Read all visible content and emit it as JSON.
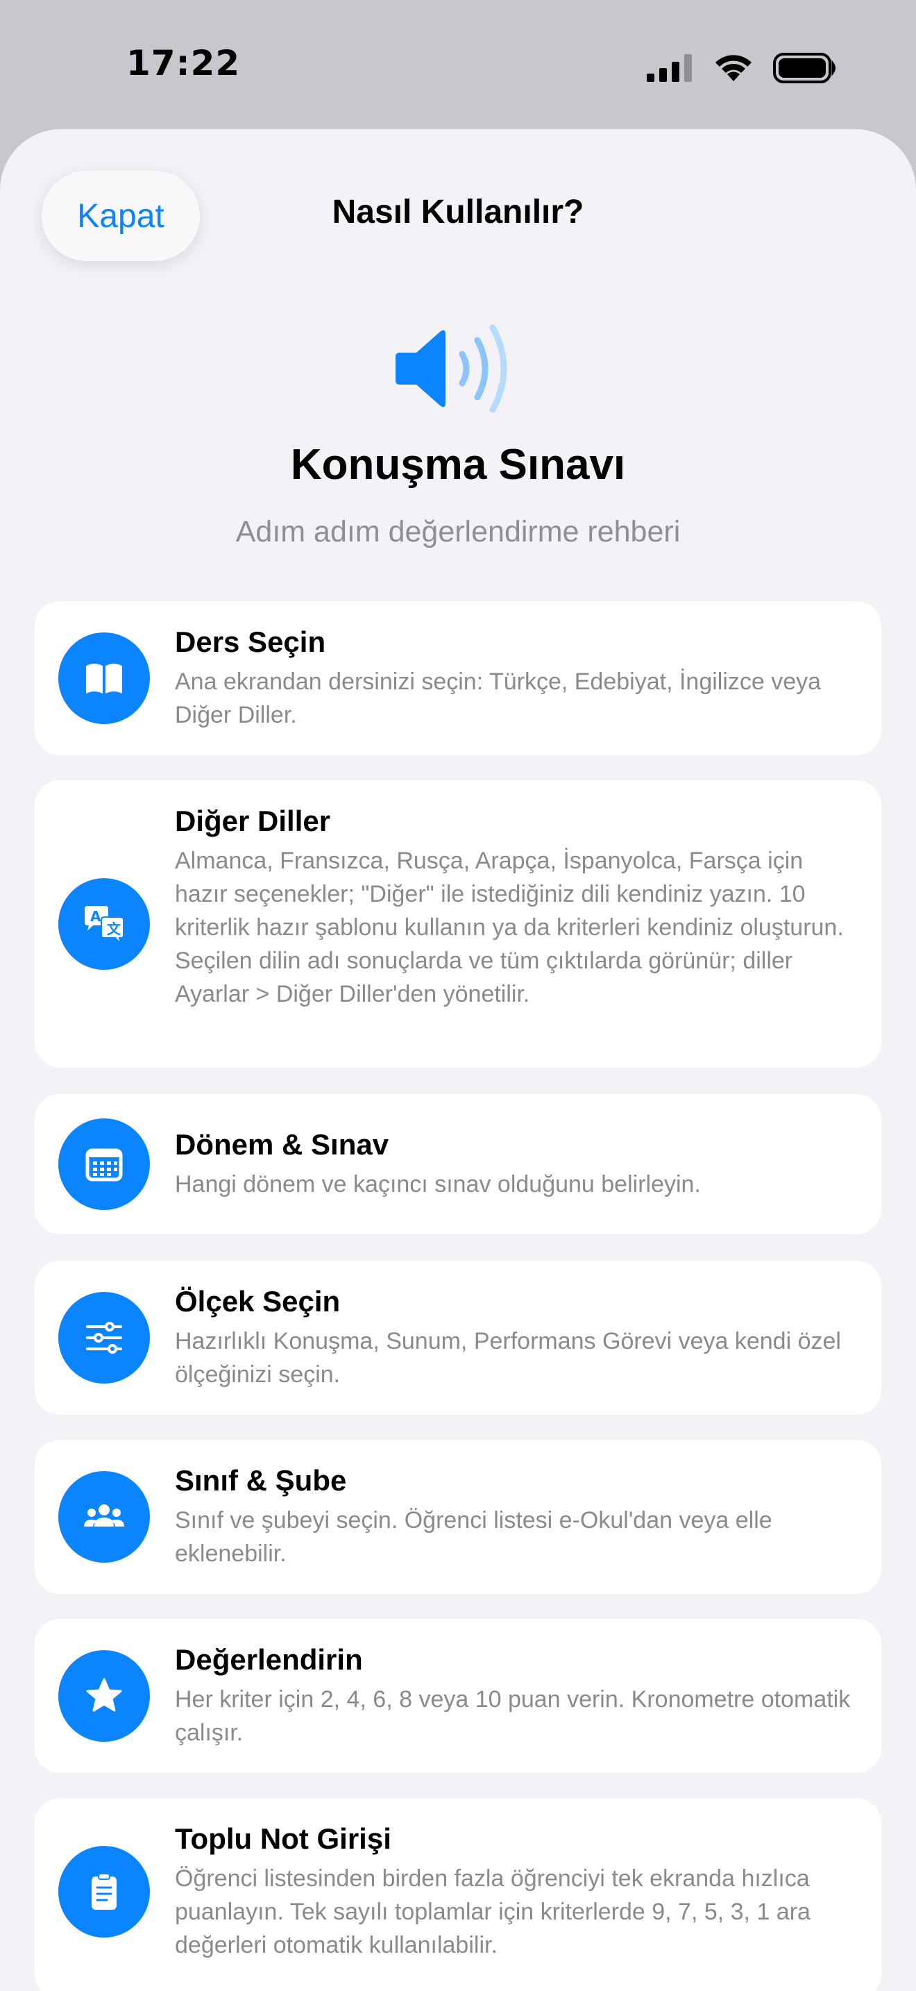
{
  "status_bar": {
    "time": "17:22",
    "icons": [
      "signal-icon",
      "wifi-icon",
      "battery-icon"
    ]
  },
  "nav": {
    "close_label": "Kapat",
    "title": "Nasıl Kullanılır?"
  },
  "hero": {
    "icon": "speaker-wave-icon",
    "title": "Konuşma Sınavı",
    "subtitle": "Adım adım değerlendirme rehberi"
  },
  "steps": [
    {
      "icon": "book-icon",
      "title": "Ders Seçin",
      "description": "Ana ekrandan dersinizi seçin: Türkçe, Edebiyat, İngilizce veya Diğer Diller."
    },
    {
      "icon": "translate-icon",
      "title": "Diğer Diller",
      "description": "Almanca, Fransızca, Rusça, Arapça, İspanyolca, Farsça için hazır seçenekler; \"Diğer\" ile istediğiniz dili kendiniz yazın. 10 kriterlik hazır şablonu kullanın ya da kriterleri kendiniz oluşturun. Seçilen dilin adı sonuçlarda ve tüm çıktılarda görünür; diller Ayarlar > Diğer Diller'den yönetilir."
    },
    {
      "icon": "calendar-icon",
      "title": "Dönem & Sınav",
      "description": "Hangi dönem ve kaçıncı sınav olduğunu belirleyin."
    },
    {
      "icon": "sliders-icon",
      "title": "Ölçek Seçin",
      "description": "Hazırlıklı Konuşma, Sunum, Performans Görevi veya kendi özel ölçeğinizi seçin."
    },
    {
      "icon": "people-icon",
      "title": "Sınıf & Şube",
      "description": "Sınıf ve şubeyi seçin. Öğrenci listesi e-Okul'dan veya elle eklenebilir."
    },
    {
      "icon": "star-icon",
      "title": "Değerlendirin",
      "description": "Her kriter için 2, 4, 6, 8 veya 10 puan verin. Kronometre otomatik çalışır."
    },
    {
      "icon": "clipboard-icon",
      "title": "Toplu Not Girişi",
      "description": "Öğrenci listesinden birden fazla öğrenciyi tek ekranda hızlıca puanlayın. Tek sayılı toplamlar için kriterlerde 9, 7, 5, 3, 1 ara değerleri otomatik kullanılabilir."
    }
  ],
  "colors": {
    "accent": "#0a84ff",
    "background": "#f2f2f7",
    "secondary_text": "#8a8a8e"
  }
}
